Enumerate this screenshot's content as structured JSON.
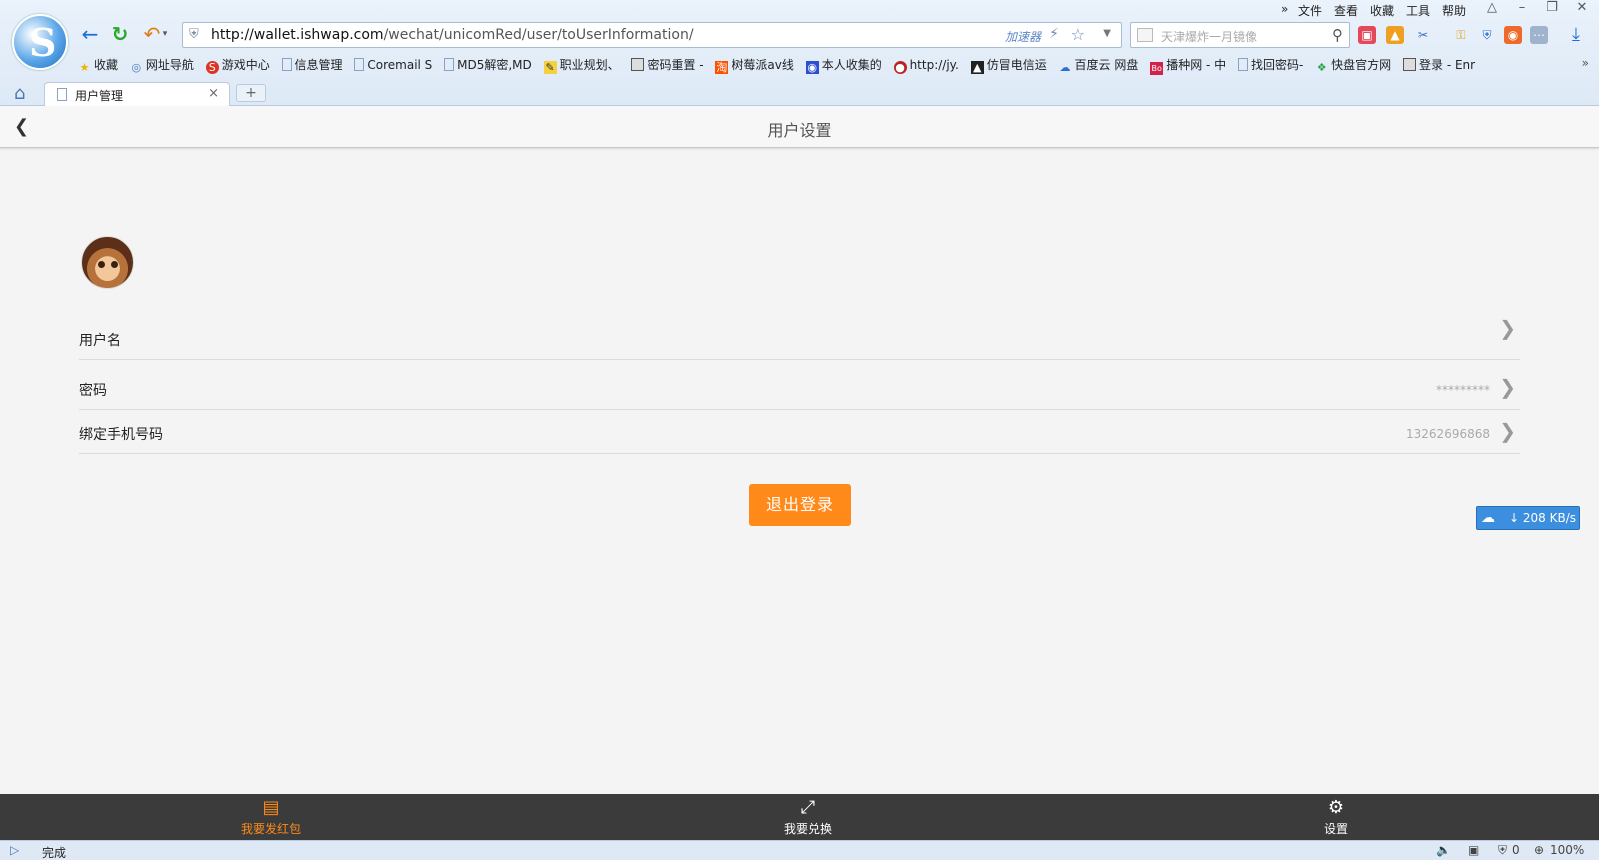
{
  "browser": {
    "menu": [
      "文件",
      "查看",
      "收藏",
      "工具",
      "帮助"
    ],
    "menu_more": "»",
    "address": {
      "url_host": "http://wallet.ishwap.com",
      "url_path": "/wechat/unicomRed/user/toUserInformation/",
      "accelerator": "加速器"
    },
    "search_placeholder": "天津爆炸一月镜像",
    "bookmarks": [
      {
        "label": "收藏",
        "icon": "star-icon"
      },
      {
        "label": "网址导航",
        "icon": "globe-icon"
      },
      {
        "label": "游戏中心",
        "icon": "game-icon"
      },
      {
        "label": "信息管理",
        "icon": "page-icon"
      },
      {
        "label": "Coremail S",
        "icon": "page-icon"
      },
      {
        "label": "MD5解密,MD",
        "icon": "page-icon"
      },
      {
        "label": "职业规划、",
        "icon": "edit-icon"
      },
      {
        "label": "密码重置 -",
        "icon": "image-icon"
      },
      {
        "label": "树莓派av线",
        "icon": "taobao-icon"
      },
      {
        "label": "本人收集的",
        "icon": "paw-icon"
      },
      {
        "label": "http://jy.",
        "icon": "site-icon"
      },
      {
        "label": "仿冒电信运",
        "icon": "site-icon"
      },
      {
        "label": "百度云 网盘",
        "icon": "cloud-icon"
      },
      {
        "label": "播种网 - 中",
        "icon": "bo-icon"
      },
      {
        "label": "找回密码-",
        "icon": "page-icon"
      },
      {
        "label": "快盘官方网",
        "icon": "kuaipan-icon"
      },
      {
        "label": "登录 - Enr",
        "icon": "image-icon"
      }
    ],
    "bookmarks_more": "»",
    "tab": {
      "label": "用户管理",
      "close": "×"
    },
    "new_tab": "+",
    "status": {
      "text": "完成",
      "zoom": "100%",
      "count": "0"
    }
  },
  "page": {
    "header_title": "用户设置",
    "rows": [
      {
        "label": "用户名",
        "value": ""
      },
      {
        "label": "密码",
        "value": "*********"
      },
      {
        "label": "绑定手机号码",
        "value": "13262696868"
      }
    ],
    "logout_label": "退出登录",
    "net_speed": "↓ 208 KB/s",
    "bottom_nav": [
      {
        "label": "我要发红包",
        "icon": "red-envelope-icon",
        "active": true
      },
      {
        "label": "我要兑换",
        "icon": "exchange-icon",
        "active": false
      },
      {
        "label": "设置",
        "icon": "gear-icon",
        "active": false
      }
    ]
  },
  "colors": {
    "accent": "#ff8a1a",
    "bottom_bar": "#3b3b3b",
    "link_blue": "#1b6fd2"
  }
}
